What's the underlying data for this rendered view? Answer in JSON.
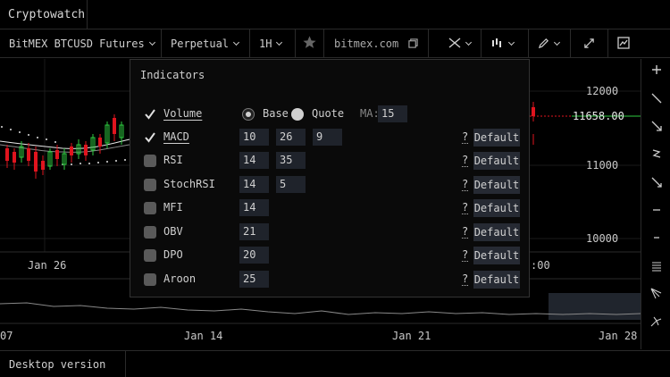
{
  "app": {
    "title": "Cryptowatch"
  },
  "toolbar": {
    "market": "BitMEX BTCUSD Futures",
    "contract": "Perpetual",
    "period": "1H",
    "exchange_link": "bitmex.com"
  },
  "chart": {
    "price_ticks": [
      "12000",
      "11000",
      "10000"
    ],
    "last_price": "11658.00",
    "time_label_upper": "Jan 26",
    "time_label_upper_right": ":00",
    "time_labels": [
      "07",
      "Jan 14",
      "Jan 21",
      "Jan 28"
    ]
  },
  "panel": {
    "title": "Indicators",
    "volume": {
      "label": "Volume",
      "checked": true,
      "base_label": "Base",
      "quote_label": "Quote",
      "ma_label": "MA:",
      "ma_value": "15"
    },
    "rows": [
      {
        "label": "MACD",
        "checked": true,
        "params": [
          "10",
          "26",
          "9"
        ]
      },
      {
        "label": "RSI",
        "checked": false,
        "params": [
          "14",
          "35"
        ]
      },
      {
        "label": "StochRSI",
        "checked": false,
        "params": [
          "14",
          "5"
        ]
      },
      {
        "label": "MFI",
        "checked": false,
        "params": [
          "14"
        ]
      },
      {
        "label": "OBV",
        "checked": false,
        "params": [
          "21"
        ]
      },
      {
        "label": "DPO",
        "checked": false,
        "params": [
          "20"
        ]
      },
      {
        "label": "Aroon",
        "checked": false,
        "params": [
          "25"
        ]
      }
    ],
    "help_label": "?",
    "default_label": "Default"
  },
  "footer": {
    "desktop_label": "Desktop version"
  },
  "colors": {
    "up": "#2ecc40",
    "down": "#e0141e",
    "price_line": "#c8c8c8"
  },
  "icons": [
    "star-icon",
    "copy-icon",
    "crosshair-icon",
    "chart-type-icon",
    "pencil-icon",
    "expand-icon",
    "screenshot-icon",
    "plus-icon",
    "line-icon",
    "arrow-icon",
    "wave-icon",
    "trend-down-icon",
    "minus-icon",
    "hline-icon",
    "menu-icon",
    "fib-icon",
    "pitchfork-icon"
  ]
}
